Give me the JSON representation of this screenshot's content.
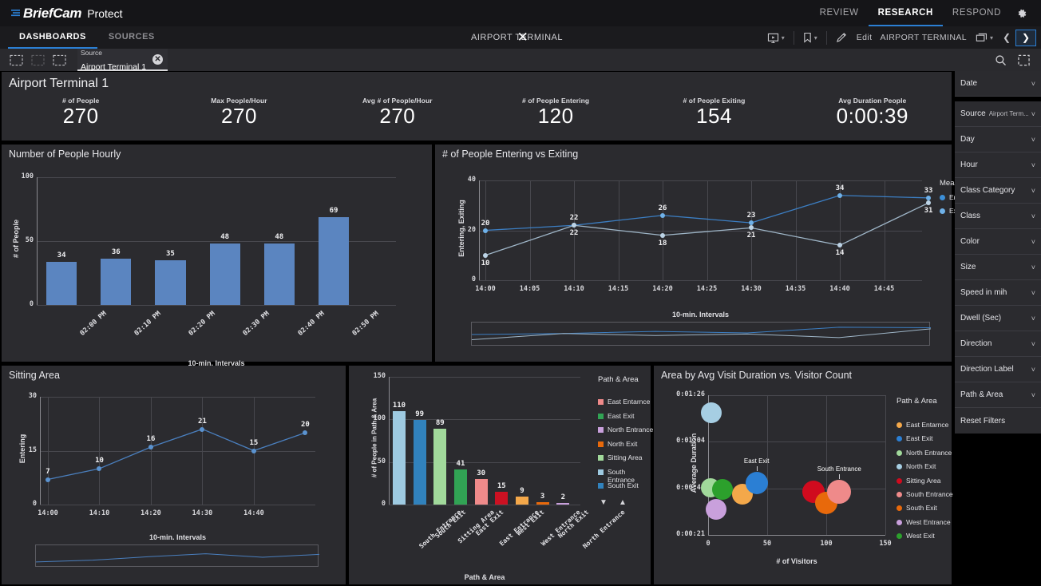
{
  "brand": {
    "name": "BriefCam",
    "product": "Protect",
    "logo_icon": "briefcam-logo-icon"
  },
  "topnav": {
    "items": [
      {
        "label": "REVIEW",
        "active": false
      },
      {
        "label": "RESEARCH",
        "active": true
      },
      {
        "label": "RESPOND",
        "active": false
      }
    ],
    "settings_icon": "gear-icon"
  },
  "tabbar": {
    "tabs": [
      {
        "label": "DASHBOARDS",
        "active": true
      },
      {
        "label": "SOURCES",
        "active": false
      }
    ],
    "center_chip": {
      "label": "AIRPORT TERMINAL",
      "close_icon": "close-icon"
    },
    "tools": {
      "presentation_icon": "presentation-icon",
      "bookmark_icon": "bookmark-icon",
      "edit_icon": "pencil-icon",
      "edit_label": "Edit",
      "source_label": "AIRPORT TERMINAL",
      "source_icon": "layers-icon",
      "prev_icon": "chevron-left-icon",
      "next_icon": "chevron-right-icon"
    }
  },
  "filterbar": {
    "undo_icon": "undo-icon",
    "redo_icon": "redo-icon",
    "clear_icon": "clear-selections-icon",
    "chip": {
      "kind": "Source",
      "value": "Airport Terminal 1",
      "remove_icon": "remove-chip-icon"
    },
    "search_icon": "search-icon",
    "snapshot_icon": "snapshot-icon"
  },
  "kpi": {
    "title": "Airport Terminal 1",
    "items": [
      {
        "label": "# of People",
        "value": "270"
      },
      {
        "label": "Max People/Hour",
        "value": "270"
      },
      {
        "label": "Avg # of People/Hour",
        "value": "270"
      },
      {
        "label": "# of People Entering",
        "value": "120"
      },
      {
        "label": "# of People Exiting",
        "value": "154"
      },
      {
        "label": "Avg Duration People",
        "value": "0:00:39"
      }
    ]
  },
  "sidebar": {
    "items": [
      {
        "label": "Date",
        "value": "",
        "caret_icon": "chevron-down-icon"
      },
      {
        "label": "Source",
        "value": "Airport Term...",
        "caret_icon": "chevron-down-icon"
      },
      {
        "label": "Day",
        "value": "",
        "caret_icon": "chevron-down-icon"
      },
      {
        "label": "Hour",
        "value": "",
        "caret_icon": "chevron-down-icon"
      },
      {
        "label": "Class Category",
        "value": "",
        "caret_icon": "chevron-down-icon"
      },
      {
        "label": "Class",
        "value": "",
        "caret_icon": "chevron-down-icon"
      },
      {
        "label": "Color",
        "value": "",
        "caret_icon": "chevron-down-icon"
      },
      {
        "label": "Size",
        "value": "",
        "caret_icon": "chevron-down-icon"
      },
      {
        "label": "Speed in mih",
        "value": "",
        "caret_icon": "chevron-down-icon"
      },
      {
        "label": "Dwell (Sec)",
        "value": "",
        "caret_icon": "chevron-down-icon"
      },
      {
        "label": "Direction",
        "value": "",
        "caret_icon": "chevron-down-icon"
      },
      {
        "label": "Direction Label",
        "value": "",
        "caret_icon": "chevron-down-icon"
      },
      {
        "label": "Path & Area",
        "value": "",
        "caret_icon": "chevron-down-icon"
      }
    ],
    "reset_label": "Reset Filters"
  },
  "colors": {
    "accent": "#2b7fd4",
    "bar_blue": "#5b85c0",
    "line_entering": "#3c7fc4",
    "line_exiting": "#9fb6c8",
    "panel_bg": "#2b2b2f",
    "canvas_bg": "#000000"
  },
  "chart_data": [
    {
      "type": "bar",
      "title": "Number of People Hourly",
      "xlabel": "10-min. Intervals",
      "ylabel": "# of People",
      "categories": [
        "02:00 PM",
        "02:10 PM",
        "02:20 PM",
        "02:30 PM",
        "02:40 PM",
        "02:50 PM"
      ],
      "values": [
        34,
        36,
        35,
        48,
        48,
        69
      ],
      "ylim": [
        0,
        100
      ],
      "yticks": [
        "0",
        "50",
        "100"
      ],
      "grid": true,
      "color": "#5b85c0"
    },
    {
      "type": "line",
      "title": "# of People Entering vs Exiting",
      "xlabel": "10-min. Intervals",
      "ylabel": "Entering, Exiting",
      "x": [
        "14:00",
        "14:10",
        "14:20",
        "14:30",
        "14:40",
        "14:50"
      ],
      "xticks": [
        "14:00",
        "14:05",
        "14:10",
        "14:15",
        "14:20",
        "14:25",
        "14:30",
        "14:35",
        "14:40",
        "14:45"
      ],
      "yticks": [
        "0",
        "20",
        "40"
      ],
      "ylim": [
        0,
        40
      ],
      "legend_title": "Measures",
      "legend_position": "right",
      "series": [
        {
          "name": "Entering",
          "values": [
            20,
            22,
            26,
            23,
            34,
            33
          ],
          "color": "#3c7fc4"
        },
        {
          "name": "Exiting",
          "values": [
            10,
            22,
            18,
            21,
            14,
            31
          ],
          "color": "#9fb6c8"
        }
      ]
    },
    {
      "type": "line",
      "title": "Sitting Area",
      "xlabel": "10-min. Intervals",
      "ylabel": "Entering",
      "x": [
        "14:00",
        "14:10",
        "14:20",
        "14:30",
        "14:40",
        "14:50"
      ],
      "xticks": [
        "14:00",
        "14:10",
        "14:20",
        "14:30",
        "14:40"
      ],
      "yticks": [
        "0",
        "15",
        "30"
      ],
      "ylim": [
        0,
        30
      ],
      "series": [
        {
          "name": "Entering",
          "values": [
            7,
            10,
            16,
            21,
            15,
            20
          ],
          "color": "#4a7fbe"
        }
      ]
    },
    {
      "type": "bar",
      "title": "",
      "xlabel": "Path & Area",
      "ylabel": "# of People in Path & Area",
      "legend_title": "Path & Area",
      "legend_position": "right",
      "ylim": [
        0,
        150
      ],
      "yticks": [
        "0",
        "50",
        "100",
        "150"
      ],
      "categories": [
        "South Entrance",
        "South Exit",
        "Sitting Area",
        "East Exit",
        "East Entrance",
        "West Exit",
        "West Entrance",
        "North Exit",
        "North Entrance"
      ],
      "values": [
        110,
        99,
        89,
        41,
        30,
        15,
        9,
        3,
        2
      ],
      "bar_colors": [
        "#9ecae1",
        "#3182bd",
        "#a1d99b",
        "#31a354",
        "#ef8a8a",
        "#cc1122",
        "#f4a84a",
        "#e8690b",
        "#c9a0dc"
      ],
      "legend": [
        {
          "label": "East Entarnce",
          "color": "#ef8a8a"
        },
        {
          "label": "East Exit",
          "color": "#31a354"
        },
        {
          "label": "North Entrance",
          "color": "#c9a0dc"
        },
        {
          "label": "North Exit",
          "color": "#e8690b"
        },
        {
          "label": "Sitting Area",
          "color": "#a1d99b"
        },
        {
          "label": "South Entrance",
          "color": "#9ecae1"
        },
        {
          "label": "South Exit",
          "color": "#3182bd"
        }
      ],
      "sort_desc_icon": "sort-descending-icon",
      "sort_asc_icon": "sort-ascending-icon"
    },
    {
      "type": "scatter",
      "title": "Area by Avg Visit Duration vs. Visitor Count",
      "xlabel": "# of Visitors",
      "ylabel": "Average Duration",
      "legend_title": "Path & Area",
      "legend_position": "right",
      "xticks": [
        "0",
        "50",
        "100",
        "150"
      ],
      "yticks": [
        "0:00:21",
        "0:00:43",
        "0:01:04",
        "0:01:26"
      ],
      "xlim": [
        0,
        150
      ],
      "points": [
        {
          "name": "North Exit",
          "x": 3,
          "y": "0:01:18",
          "r": 13,
          "color": "#a6cee3",
          "label": ""
        },
        {
          "name": "North Entrance",
          "x": 2,
          "y": "0:00:43",
          "r": 12,
          "color": "#a1d99b",
          "label": ""
        },
        {
          "name": "West Exit",
          "x": 12,
          "y": "0:00:42",
          "r": 13,
          "color": "#2ca02c",
          "label": ""
        },
        {
          "name": "East Entarnce",
          "x": 29,
          "y": "0:00:40",
          "r": 13,
          "color": "#f4a84a",
          "label": ""
        },
        {
          "name": "East Exit",
          "x": 41,
          "y": "0:00:45",
          "r": 14,
          "color": "#2b7fd4",
          "label": "East Exit"
        },
        {
          "name": "West Entrance",
          "x": 7,
          "y": "0:00:33",
          "r": 13,
          "color": "#c9a0dc",
          "label": ""
        },
        {
          "name": "Sitting Area",
          "x": 89,
          "y": "0:00:41",
          "r": 14,
          "color": "#d00b1e",
          "label": ""
        },
        {
          "name": "South Exit",
          "x": 100,
          "y": "0:00:36",
          "r": 14,
          "color": "#e8690b",
          "label": ""
        },
        {
          "name": "South Entrance",
          "x": 111,
          "y": "0:00:41",
          "r": 15,
          "color": "#ef8a8a",
          "label": "South Entrance"
        }
      ],
      "legend": [
        {
          "label": "East Entarnce",
          "color": "#f4a84a"
        },
        {
          "label": "East Exit",
          "color": "#2b7fd4"
        },
        {
          "label": "North Entrance",
          "color": "#a1d99b"
        },
        {
          "label": "North Exit",
          "color": "#a6cee3"
        },
        {
          "label": "Sitting Area",
          "color": "#d00b1e"
        },
        {
          "label": "South Entrance",
          "color": "#ef8a8a"
        },
        {
          "label": "South Exit",
          "color": "#e8690b"
        },
        {
          "label": "West Entrance",
          "color": "#c9a0dc"
        },
        {
          "label": "West Exit",
          "color": "#2ca02c"
        }
      ]
    }
  ]
}
